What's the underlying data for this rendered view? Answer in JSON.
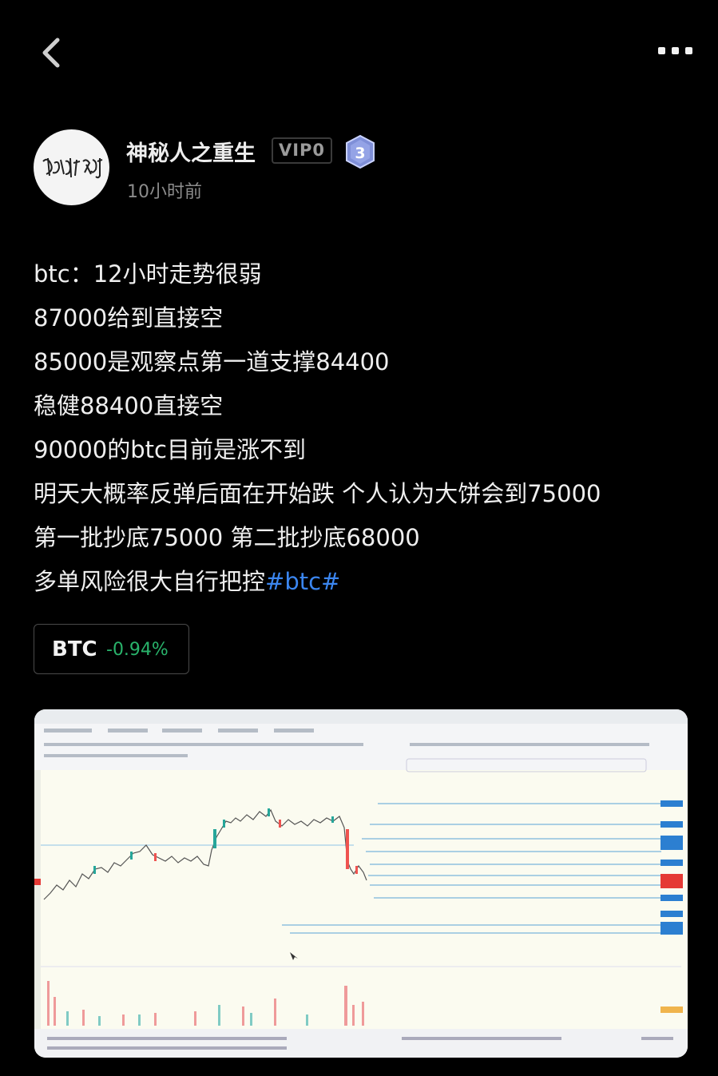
{
  "header": {
    "back_icon": "chevron-left-icon",
    "more_icon": "more-dots-icon"
  },
  "author": {
    "name": "神秘人之重生",
    "vip": "VIP0",
    "level": "3",
    "time": "10小时前",
    "avatar_text": "感谢陪伴"
  },
  "post": {
    "lines": [
      "btc：12小时走势很弱",
      "87000给到直接空",
      "85000是观察点第一道支撑84400",
      "稳健88400直接空",
      "90000的btc目前是涨不到",
      "明天大概率反弹后面在开始跌 个人认为大饼会到75000",
      "第一批抄底75000 第二批抄底68000",
      "多单风险很大自行把控"
    ],
    "hashtag": "#btc#"
  },
  "coin": {
    "symbol": "BTC",
    "change": "-0.94%",
    "change_color": "#29b36b"
  },
  "colors": {
    "background": "#000000",
    "hashtag": "#3b86f0",
    "up": "#26a69a",
    "down": "#ef5350"
  }
}
